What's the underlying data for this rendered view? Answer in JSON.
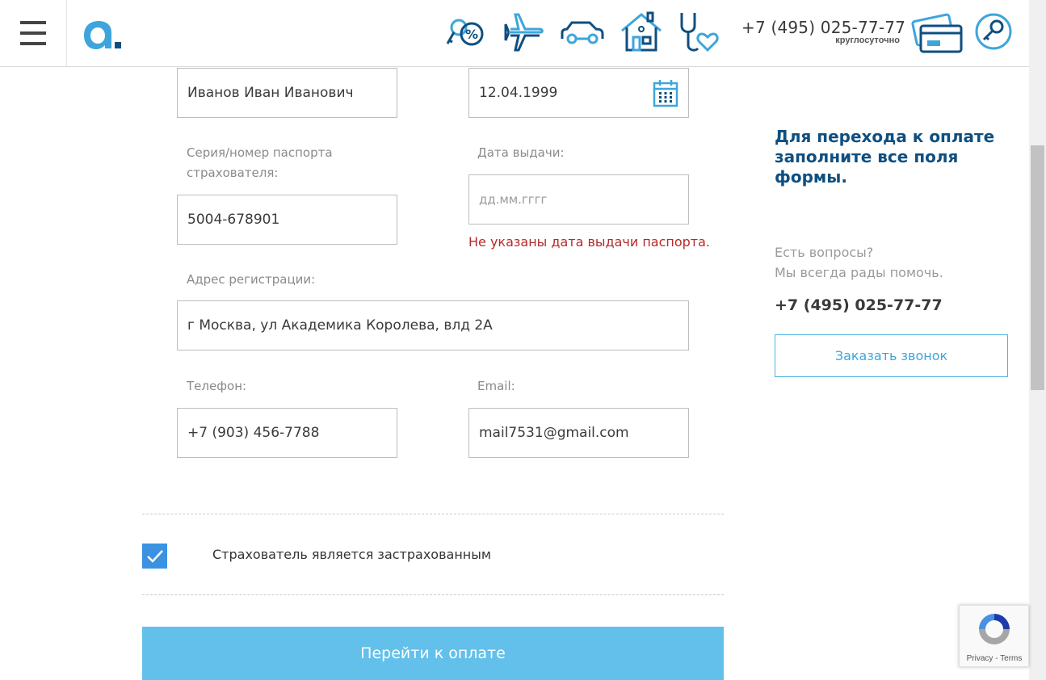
{
  "header": {
    "phone": "+7 (495) 025-77-77",
    "phone_sub": "круглосуточно",
    "nav_icons": [
      "mortgage-percent-icon",
      "airplane-travel-icon",
      "car-icon",
      "house-icon",
      "stethoscope-health-icon"
    ]
  },
  "form": {
    "fio_value": "Иванов Иван Иванович",
    "birthdate_value": "12.04.1999",
    "passport_label": "Серия/номер паспорта страхователя:",
    "passport_label_line1": "Серия/номер паспорта",
    "passport_label_line2": "страхователя:",
    "passport_value": "5004-678901",
    "issue_date_label": "Дата выдачи:",
    "issue_date_placeholder": "дд.мм.гггг",
    "issue_date_error": "Не указаны дата выдачи паспорта.",
    "address_label": "Адрес регистрации:",
    "address_value": "г Москва, ул Академика Королева, влд 2А",
    "phone_label": "Телефон:",
    "phone_value": "+7 (903) 456-7788",
    "email_label": "Email:",
    "email_value": "mail7531@gmail.com",
    "insured_checkbox_label": "Страхователь является застрахованным",
    "insured_checked": true,
    "pay_button": "Перейти к оплате"
  },
  "sidebar": {
    "notice": "Для перехода к оплате заполните все поля формы.",
    "notice_line1": "Для перехода к оплате",
    "notice_line2": "заполните все поля",
    "notice_line3": "формы.",
    "questions_line1": "Есть вопросы?",
    "questions_line2": "Мы всегда рады помочь.",
    "phone": "+7 (495) 025-77-77",
    "callback_button": "Заказать звонок"
  },
  "recaptcha": {
    "text": "Privacy - Terms"
  },
  "colors": {
    "brand_blue": "#3ea5dc",
    "dark_blue": "#0f4f80",
    "error_red": "#b52a2a",
    "pay_button": "#63c0ea",
    "checkbox": "#3a92e0"
  }
}
